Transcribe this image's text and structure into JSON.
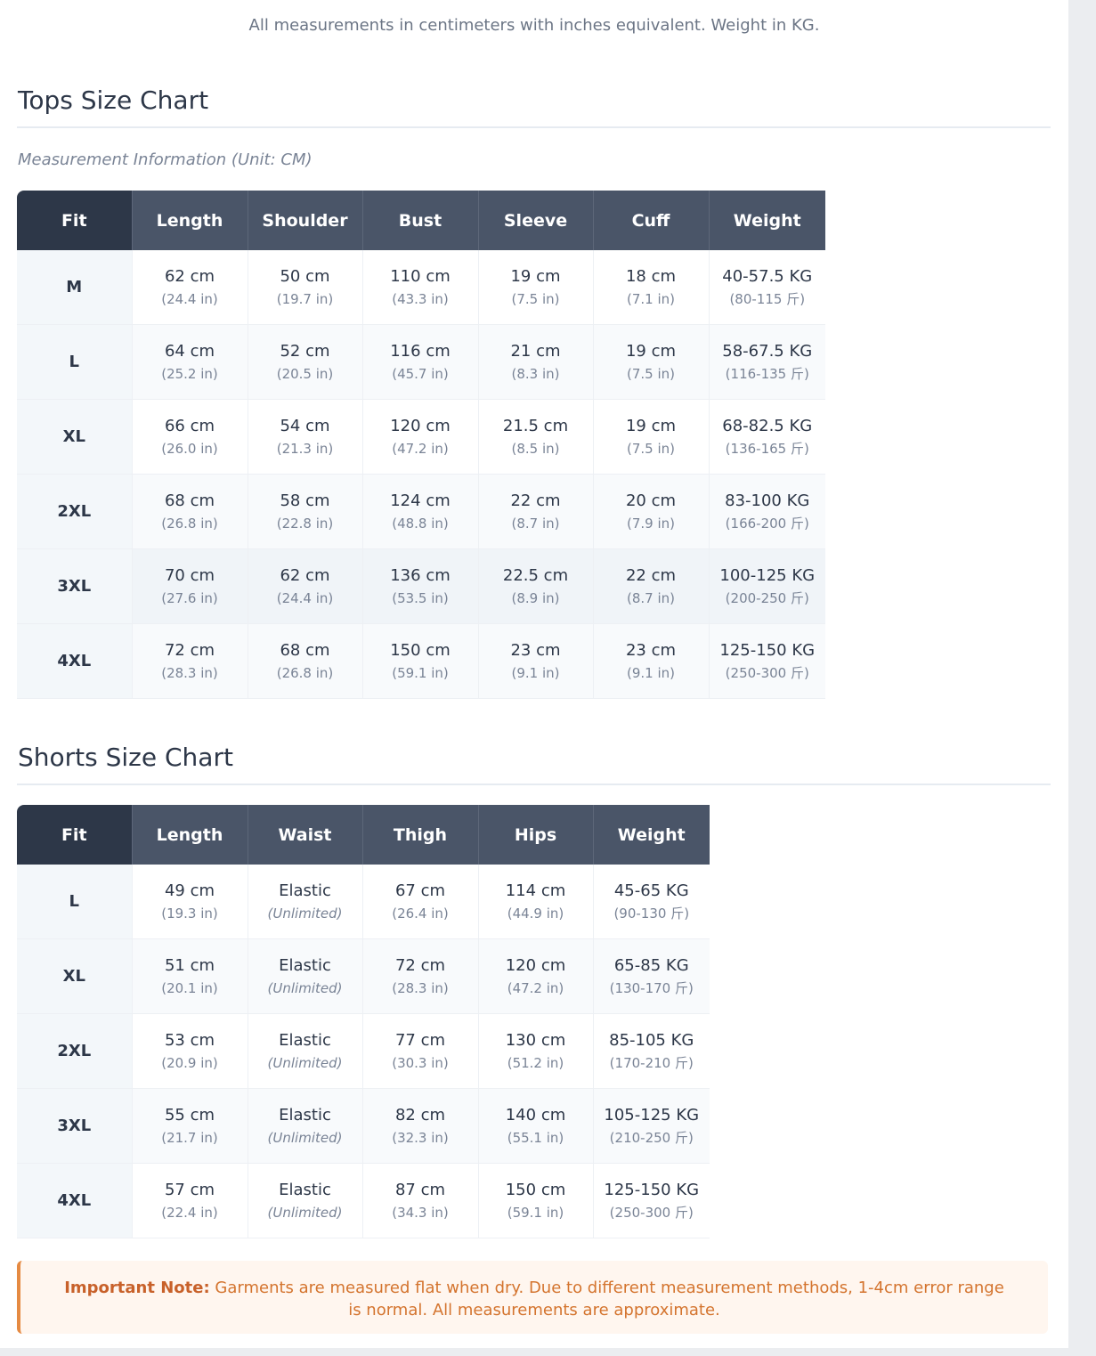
{
  "header": {
    "subtitle": "All measurements in centimeters with inches equivalent. Weight in KG."
  },
  "tops": {
    "title": "Tops Size Chart",
    "measurement_info": "Measurement Information (Unit: CM)",
    "columns": [
      "Fit",
      "Length",
      "Shoulder",
      "Bust",
      "Sleeve",
      "Cuff",
      "Weight"
    ],
    "rows": [
      {
        "fit": "M",
        "cells": [
          [
            "62 cm",
            "(24.4 in)"
          ],
          [
            "50 cm",
            "(19.7 in)"
          ],
          [
            "110 cm",
            "(43.3 in)"
          ],
          [
            "19 cm",
            "(7.5 in)"
          ],
          [
            "18 cm",
            "(7.1 in)"
          ],
          [
            "40-57.5 KG",
            "(80-115 斤)"
          ]
        ]
      },
      {
        "fit": "L",
        "cells": [
          [
            "64 cm",
            "(25.2 in)"
          ],
          [
            "52 cm",
            "(20.5 in)"
          ],
          [
            "116 cm",
            "(45.7 in)"
          ],
          [
            "21 cm",
            "(8.3 in)"
          ],
          [
            "19 cm",
            "(7.5 in)"
          ],
          [
            "58-67.5 KG",
            "(116-135 斤)"
          ]
        ]
      },
      {
        "fit": "XL",
        "cells": [
          [
            "66 cm",
            "(26.0 in)"
          ],
          [
            "54 cm",
            "(21.3 in)"
          ],
          [
            "120 cm",
            "(47.2 in)"
          ],
          [
            "21.5 cm",
            "(8.5 in)"
          ],
          [
            "19 cm",
            "(7.5 in)"
          ],
          [
            "68-82.5 KG",
            "(136-165 斤)"
          ]
        ]
      },
      {
        "fit": "2XL",
        "cells": [
          [
            "68 cm",
            "(26.8 in)"
          ],
          [
            "58 cm",
            "(22.8 in)"
          ],
          [
            "124 cm",
            "(48.8 in)"
          ],
          [
            "22 cm",
            "(8.7 in)"
          ],
          [
            "20 cm",
            "(7.9 in)"
          ],
          [
            "83-100 KG",
            "(166-200 斤)"
          ]
        ]
      },
      {
        "fit": "3XL",
        "cells": [
          [
            "70 cm",
            "(27.6 in)"
          ],
          [
            "62 cm",
            "(24.4 in)"
          ],
          [
            "136 cm",
            "(53.5 in)"
          ],
          [
            "22.5 cm",
            "(8.9 in)"
          ],
          [
            "22 cm",
            "(8.7 in)"
          ],
          [
            "100-125 KG",
            "(200-250 斤)"
          ]
        ]
      },
      {
        "fit": "4XL",
        "cells": [
          [
            "72 cm",
            "(28.3 in)"
          ],
          [
            "68 cm",
            "(26.8 in)"
          ],
          [
            "150 cm",
            "(59.1 in)"
          ],
          [
            "23 cm",
            "(9.1 in)"
          ],
          [
            "23 cm",
            "(9.1 in)"
          ],
          [
            "125-150 KG",
            "(250-300 斤)"
          ]
        ]
      }
    ]
  },
  "shorts": {
    "title": "Shorts Size Chart",
    "columns": [
      "Fit",
      "Length",
      "Waist",
      "Thigh",
      "Hips",
      "Weight"
    ],
    "rows": [
      {
        "fit": "L",
        "cells": [
          [
            "49 cm",
            "(19.3 in)"
          ],
          [
            "Elastic",
            "(Unlimited)"
          ],
          [
            "67 cm",
            "(26.4 in)"
          ],
          [
            "114 cm",
            "(44.9 in)"
          ],
          [
            "45-65 KG",
            "(90-130 斤)"
          ]
        ]
      },
      {
        "fit": "XL",
        "cells": [
          [
            "51 cm",
            "(20.1 in)"
          ],
          [
            "Elastic",
            "(Unlimited)"
          ],
          [
            "72 cm",
            "(28.3 in)"
          ],
          [
            "120 cm",
            "(47.2 in)"
          ],
          [
            "65-85 KG",
            "(130-170 斤)"
          ]
        ]
      },
      {
        "fit": "2XL",
        "cells": [
          [
            "53 cm",
            "(20.9 in)"
          ],
          [
            "Elastic",
            "(Unlimited)"
          ],
          [
            "77 cm",
            "(30.3 in)"
          ],
          [
            "130 cm",
            "(51.2 in)"
          ],
          [
            "85-105 KG",
            "(170-210 斤)"
          ]
        ]
      },
      {
        "fit": "3XL",
        "cells": [
          [
            "55 cm",
            "(21.7 in)"
          ],
          [
            "Elastic",
            "(Unlimited)"
          ],
          [
            "82 cm",
            "(32.3 in)"
          ],
          [
            "140 cm",
            "(55.1 in)"
          ],
          [
            "105-125 KG",
            "(210-250 斤)"
          ]
        ]
      },
      {
        "fit": "4XL",
        "cells": [
          [
            "57 cm",
            "(22.4 in)"
          ],
          [
            "Elastic",
            "(Unlimited)"
          ],
          [
            "87 cm",
            "(34.3 in)"
          ],
          [
            "150 cm",
            "(59.1 in)"
          ],
          [
            "125-150 KG",
            "(250-300 斤)"
          ]
        ]
      }
    ]
  },
  "note": {
    "label": "Important Note:",
    "text": " Garments are measured flat when dry. Due to different measurement methods, 1-4cm error range is normal. All measurements are approximate."
  },
  "colors": {
    "header_dark": "#2d3748",
    "header": "#4a5568",
    "note_accent": "#e58a42",
    "note_text": "#d4742e"
  }
}
